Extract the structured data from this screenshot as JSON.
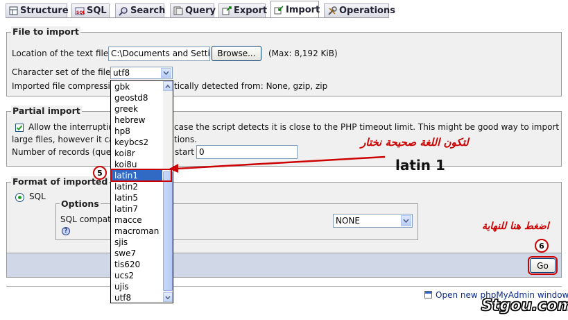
{
  "tabs": [
    {
      "label": "Structure",
      "icon": "structure-icon"
    },
    {
      "label": "SQL",
      "icon": "sql-icon"
    },
    {
      "label": "Search",
      "icon": "search-icon"
    },
    {
      "label": "Query",
      "icon": "query-icon"
    },
    {
      "label": "Export",
      "icon": "export-icon"
    },
    {
      "label": "Import",
      "icon": "import-icon",
      "active": true
    },
    {
      "label": "Operations",
      "icon": "operations-icon"
    }
  ],
  "file_import": {
    "legend": "File to import",
    "location_label": "Location of the text file",
    "location_value": "C:\\Documents and Setti",
    "browse_label": "Browse...",
    "max_note": "(Max: 8,192 KiB)",
    "charset_label": "Character set of the file:",
    "charset_value": "utf8",
    "compression_left": "Imported file compressio",
    "compression_right": "tically detected from: None, gzip, zip"
  },
  "charset_options": [
    "gbk",
    "geostd8",
    "greek",
    "hebrew",
    "hp8",
    "keybcs2",
    "koi8r",
    "koi8u",
    "latin1",
    "latin2",
    "latin5",
    "latin7",
    "macce",
    "macroman",
    "sjis",
    "swe7",
    "tis620",
    "ucs2",
    "ujis",
    "utf8"
  ],
  "charset_selected": "latin1",
  "partial": {
    "legend": "Partial import",
    "allow_left": "Allow the interruption",
    "allow_right": "case the script detects it is close to the PHP timeout limit. This might be good way to import",
    "line2_left": "large files, however it can",
    "line2_right": "tions.",
    "records_left": "Number of records (queri",
    "records_right": "start",
    "records_value": "0"
  },
  "format": {
    "legend_left": "Format of imported",
    "sql_label": "SQL",
    "options_legend": "Options",
    "compat_label": "SQL compat",
    "help_glyph": "?",
    "compat_value": "NONE"
  },
  "go_label": "Go",
  "open_window_link": "Open new phpMyAdmin window",
  "annotations": {
    "step5": "5",
    "step6": "6",
    "arabic_choose": "لتكون اللغة صحيحة نختار",
    "latin_label": "latin 1",
    "arabic_press": "اضغط هنا للنهاية",
    "watermark": "Stgou.com"
  },
  "colors": {
    "annotation_red": "#cc0000",
    "selection_blue": "#316ac5",
    "panel_bg": "#f0f0f0",
    "submit_bar_bg": "#d0d8e8"
  }
}
